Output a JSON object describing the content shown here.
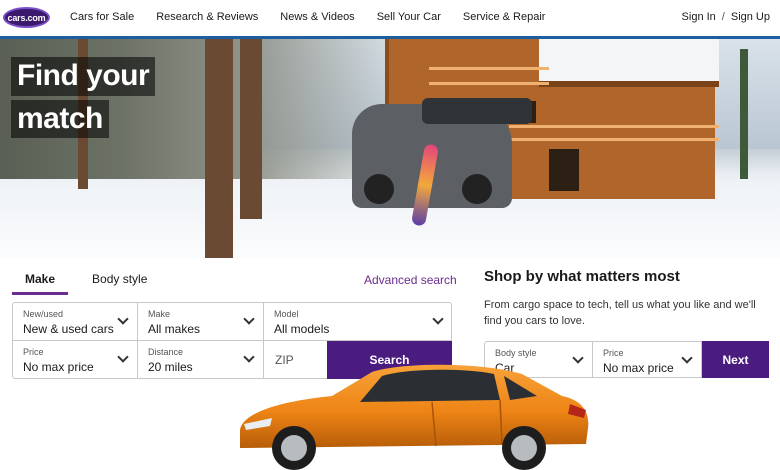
{
  "header": {
    "logo_text": "cars.com",
    "nav": [
      "Cars for Sale",
      "Research & Reviews",
      "News & Videos",
      "Sell Your Car",
      "Service & Repair"
    ],
    "sign_in": "Sign In",
    "separator": "/",
    "sign_up": "Sign Up"
  },
  "hero": {
    "title_line1": "Find your",
    "title_line2": "match"
  },
  "search": {
    "tabs": [
      "Make",
      "Body style"
    ],
    "active_tab": "Make",
    "advanced_link": "Advanced search",
    "fields": {
      "new_used": {
        "label": "New/used",
        "value": "New & used cars"
      },
      "make": {
        "label": "Make",
        "value": "All makes"
      },
      "model": {
        "label": "Model",
        "value": "All models"
      },
      "price": {
        "label": "Price",
        "value": "No max price"
      },
      "distance": {
        "label": "Distance",
        "value": "20 miles"
      },
      "zip_placeholder": "ZIP"
    },
    "button": "Search"
  },
  "shop": {
    "title": "Shop by what matters most",
    "description": "From cargo space to tech, tell us what you like and we'll find you cars to love.",
    "body_style": {
      "label": "Body style",
      "value": "Car"
    },
    "price": {
      "label": "Price",
      "value": "No max price"
    },
    "button": "Next"
  },
  "colors": {
    "brand_purple": "#4a1c80",
    "link_purple": "#6b2b8f",
    "car_orange": "#f08a1c"
  }
}
